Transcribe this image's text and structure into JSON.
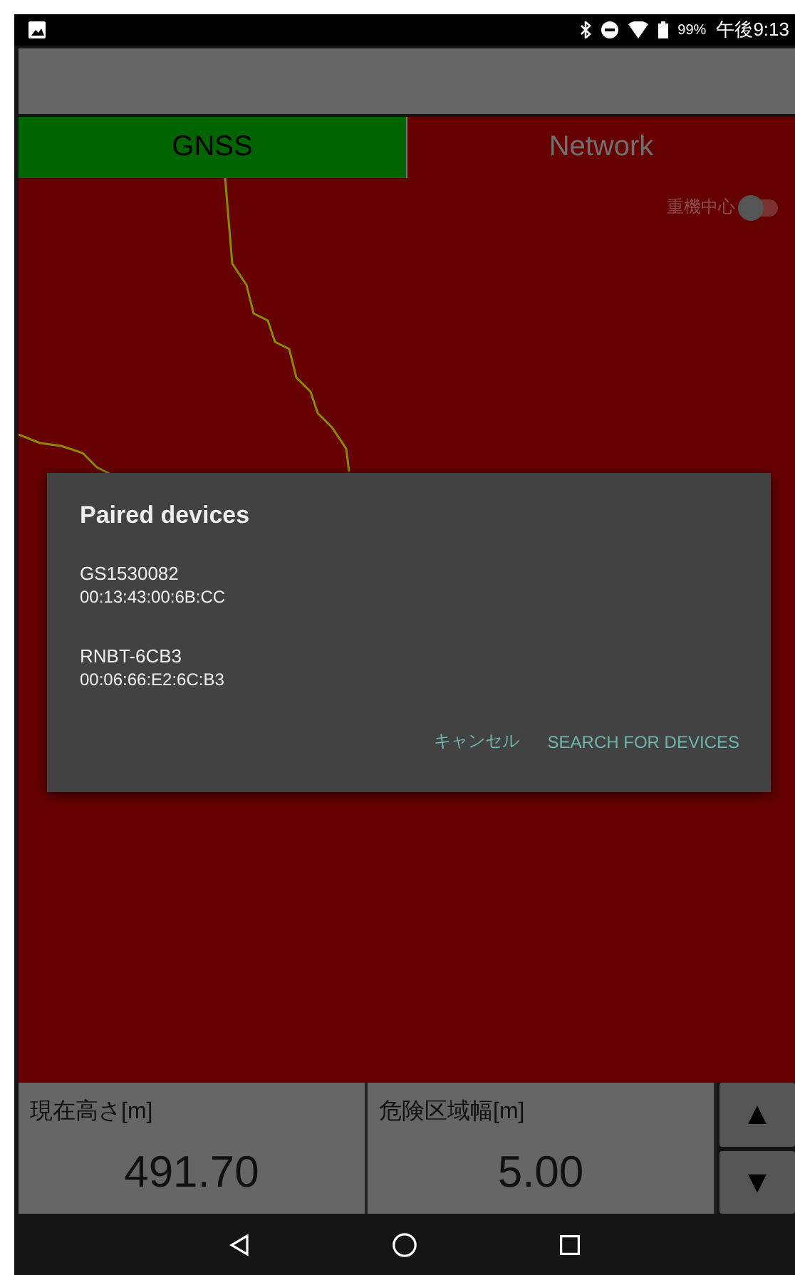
{
  "status_bar": {
    "battery": "99%",
    "time": "午後9:13"
  },
  "tabs": [
    {
      "label": "GNSS",
      "selected": true
    },
    {
      "label": "Network",
      "selected": false
    }
  ],
  "map": {
    "toggle": {
      "label": "重機中心",
      "on": false
    }
  },
  "dialog": {
    "title": "Paired devices",
    "devices": [
      {
        "name": "GS1530082",
        "address": "00:13:43:00:6B:CC"
      },
      {
        "name": "RNBT-6CB3",
        "address": "00:06:66:E2:6C:B3"
      }
    ],
    "buttons": [
      "キャンセル",
      "SEARCH FOR DEVICES"
    ]
  },
  "readouts": [
    {
      "label": "現在高さ[m]",
      "value": "491.70"
    },
    {
      "label": "危険区域幅[m]",
      "value": "5.00"
    }
  ],
  "steppers": [
    "▲",
    "▼"
  ]
}
